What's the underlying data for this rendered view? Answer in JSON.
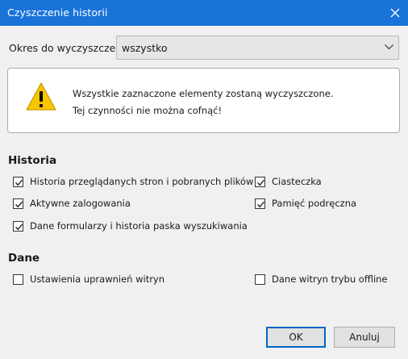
{
  "window": {
    "title": "Czyszczenie historii"
  },
  "period": {
    "label": "Okres do wyczyszczenia:",
    "value": "wszystko"
  },
  "warning": {
    "line1": "Wszystkie zaznaczone elementy zostaną wyczyszczone.",
    "line2": "Tej czynności nie można cofnąć!"
  },
  "history": {
    "title": "Historia",
    "items": [
      {
        "label": "Historia przeglądanych stron i pobranych plików",
        "checked": true
      },
      {
        "label": "Ciasteczka",
        "checked": true
      },
      {
        "label": "Aktywne zalogowania",
        "checked": true
      },
      {
        "label": "Pamięć podręczna",
        "checked": true
      },
      {
        "label": "Dane formularzy i historia paska wyszukiwania",
        "checked": true
      }
    ]
  },
  "data": {
    "title": "Dane",
    "items": [
      {
        "label": "Ustawienia uprawnień witryn",
        "checked": false
      },
      {
        "label": "Dane witryn trybu offline",
        "checked": false
      }
    ]
  },
  "buttons": {
    "ok": "OK",
    "cancel": "Anuluj"
  },
  "colors": {
    "titlebar": "#1a73d9",
    "warning_icon": "#f7c600"
  }
}
